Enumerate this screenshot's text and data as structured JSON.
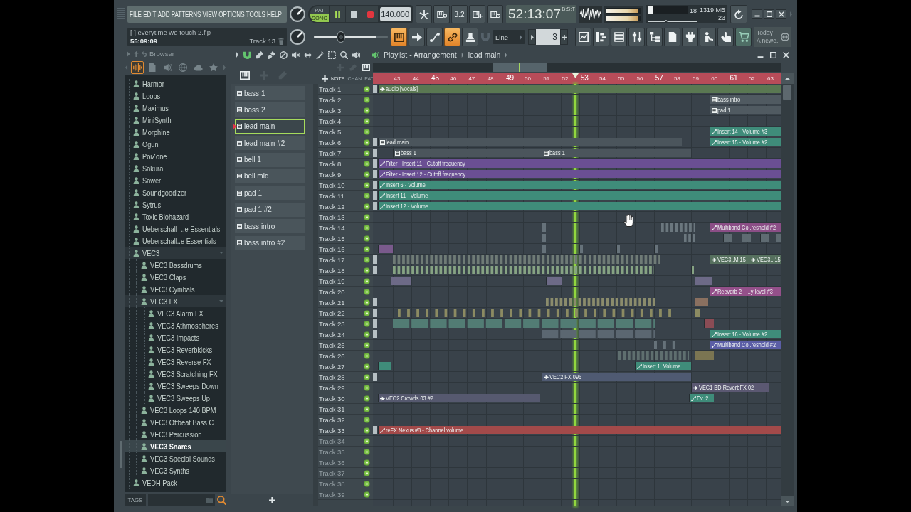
{
  "menu": [
    "FILE",
    "EDIT",
    "ADD",
    "PATTERNS",
    "VIEW",
    "OPTIONS",
    "TOOLS",
    "HELP"
  ],
  "hint_bar": {
    "title": "[ ] everytime we touch 2.flp",
    "time": "55:09:09",
    "target": "Track 13"
  },
  "transport": {
    "modes": [
      {
        "label": "PAT",
        "selected": false
      },
      {
        "label": "SONG",
        "selected": true
      }
    ],
    "playing": true,
    "tempo": "140.000"
  },
  "record_options": [
    {
      "kind": "metronome",
      "on": false
    },
    {
      "kind": "wait",
      "on": false
    },
    {
      "kind": "countdown",
      "label": "3.2",
      "on": false
    },
    {
      "kind": "step",
      "on": false
    },
    {
      "kind": "loop",
      "on": false
    }
  ],
  "song_position": {
    "time": "52:13:07",
    "unit": "B:S:T"
  },
  "output": {
    "meters": [
      {
        "level": 0.93
      },
      {
        "level": 0.93
      }
    ]
  },
  "performance": {
    "cpu": {
      "level": 0.12
    },
    "cpu_reading": "18",
    "memory": "1319 MB",
    "polyphony": "23"
  },
  "master_pitch": {
    "level": 0.37
  },
  "tools": [
    {
      "kind": "typing",
      "on": true
    },
    {
      "kind": "arrow",
      "on": false
    },
    {
      "kind": "curve",
      "on": false
    },
    {
      "kind": "link",
      "on": true
    },
    {
      "kind": "stamp",
      "on": false
    }
  ],
  "snap": {
    "value": "Line"
  },
  "pattern_number": {
    "value": "3"
  },
  "windows": [
    {
      "kind": "playlist"
    },
    {
      "kind": "piano_roll"
    },
    {
      "kind": "channel_rack"
    },
    {
      "kind": "mixer"
    },
    {
      "kind": "project"
    },
    {
      "kind": "document"
    },
    {
      "kind": "plugin"
    },
    {
      "kind": "figure"
    },
    {
      "kind": "touch"
    },
    {
      "kind": "shop"
    }
  ],
  "news": {
    "title": "Today",
    "text": "A newe.."
  },
  "browser": {
    "title": "Browser",
    "tabs": [
      {
        "kind": "all",
        "selected": true
      },
      {
        "kind": "files",
        "selected": false
      },
      {
        "kind": "plugins",
        "selected": false
      },
      {
        "kind": "online",
        "selected": false
      },
      {
        "kind": "cloud",
        "selected": false
      },
      {
        "kind": "favorites",
        "selected": false
      }
    ],
    "tree": [
      {
        "label": "Harmor",
        "expanded": false,
        "selected": false
      },
      {
        "label": "Loops",
        "expanded": false,
        "selected": false
      },
      {
        "label": "Maximus",
        "expanded": false,
        "selected": false
      },
      {
        "label": "MiniSynth",
        "expanded": false,
        "selected": false
      },
      {
        "label": "Morphine",
        "expanded": false,
        "selected": false
      },
      {
        "label": "Ogun",
        "expanded": false,
        "selected": false
      },
      {
        "label": "PoiZone",
        "expanded": false,
        "selected": false
      },
      {
        "label": "Sakura",
        "expanded": false,
        "selected": false
      },
      {
        "label": "Sawer",
        "expanded": false,
        "selected": false
      },
      {
        "label": "Soundgoodizer",
        "expanded": false,
        "selected": false
      },
      {
        "label": "Sytrus",
        "expanded": false,
        "selected": false
      },
      {
        "label": "Toxic Biohazard",
        "expanded": false,
        "selected": false
      },
      {
        "label": "Ueberschall -..e Essentials",
        "expanded": false,
        "selected": false
      },
      {
        "label": "Ueberschall..e Essentials",
        "expanded": false,
        "selected": false
      },
      {
        "label": "VEC3",
        "expanded": true,
        "selected": false,
        "children": [
          {
            "label": "VEC3 Bassdrums",
            "expanded": false,
            "selected": false
          },
          {
            "label": "VEC3 Claps",
            "expanded": false,
            "selected": false
          },
          {
            "label": "VEC3 Cymbals",
            "expanded": false,
            "selected": false
          },
          {
            "label": "VEC3 FX",
            "expanded": true,
            "selected": false,
            "children": [
              {
                "label": "VEC3 Alarm FX",
                "expanded": false,
                "selected": false
              },
              {
                "label": "VEC3 Athmospheres",
                "expanded": false,
                "selected": false
              },
              {
                "label": "VEC3 Impacts",
                "expanded": false,
                "selected": false
              },
              {
                "label": "VEC3 Reverbkicks",
                "expanded": false,
                "selected": false
              },
              {
                "label": "VEC3 Reverse FX",
                "expanded": false,
                "selected": false
              },
              {
                "label": "VEC3 Scratching FX",
                "expanded": false,
                "selected": false
              },
              {
                "label": "VEC3 Sweeps Down",
                "expanded": false,
                "selected": false
              },
              {
                "label": "VEC3 Sweeps Up",
                "expanded": false,
                "selected": false
              }
            ]
          },
          {
            "label": "VEC3 Loops 140 BPM",
            "expanded": false,
            "selected": false
          },
          {
            "label": "VEC3 Offbeat Bass C",
            "expanded": false,
            "selected": false
          },
          {
            "label": "VEC3 Percussion",
            "expanded": false,
            "selected": false
          },
          {
            "label": "VEC3 Snares",
            "expanded": false,
            "selected": true
          },
          {
            "label": "VEC3 Special Sounds",
            "expanded": false,
            "selected": false
          },
          {
            "label": "VEC3 Synths",
            "expanded": false,
            "selected": false
          }
        ]
      },
      {
        "label": "VEDH Pack",
        "expanded": false,
        "selected": false
      }
    ],
    "tags_label": "TAGS"
  },
  "playlist": {
    "title": "Playlist - Arrangement",
    "pattern": "lead main",
    "patterns": [
      {
        "label": "bass 1",
        "selected": false
      },
      {
        "label": "bass 2",
        "selected": false
      },
      {
        "label": "lead main",
        "selected": true
      },
      {
        "label": "lead main #2",
        "selected": false
      },
      {
        "label": "bell 1",
        "selected": false
      },
      {
        "label": "bell mid",
        "selected": false
      },
      {
        "label": "pad 1",
        "selected": false
      },
      {
        "label": "pad 1 #2",
        "selected": false
      },
      {
        "label": "bass intro",
        "selected": false
      },
      {
        "label": "bass intro #2",
        "selected": false
      }
    ],
    "filters": [
      {
        "label": "NOTE",
        "selected": true
      },
      {
        "label": "CHAN",
        "selected": false
      },
      {
        "label": "PAT",
        "selected": false
      }
    ],
    "ruler": [
      "43",
      "44",
      "45",
      "46",
      "47",
      "48",
      "49",
      "50",
      "51",
      "52",
      "53",
      "54",
      "55",
      "56",
      "57",
      "58",
      "59",
      "60",
      "61",
      "62",
      "63"
    ],
    "tracks": [
      {
        "name": "Track 1",
        "on": true,
        "dim": false,
        "earlier": true,
        "clips": [
          {
            "kind": "audio",
            "label": "audio [vocals]",
            "color": "#5a7852"
          }
        ]
      },
      {
        "name": "Track 2",
        "on": true,
        "dim": false,
        "earlier": false,
        "clips": [
          {
            "kind": "pattern",
            "label": "bass intro",
            "color": "#505a61"
          }
        ]
      },
      {
        "name": "Track 3",
        "on": true,
        "dim": false,
        "earlier": false,
        "clips": [
          {
            "kind": "pattern",
            "label": "pad 1",
            "color": "#505a61"
          }
        ]
      },
      {
        "name": "Track 4",
        "on": true,
        "dim": false,
        "earlier": false
      },
      {
        "name": "Track 5",
        "on": true,
        "dim": false,
        "earlier": false,
        "clips": [
          {
            "kind": "automation",
            "label": "Insert 14 - Volume #3",
            "color": "#3f8c7a"
          }
        ]
      },
      {
        "name": "Track 6",
        "on": true,
        "dim": false,
        "earlier": true,
        "clips": [
          {
            "kind": "pattern",
            "label": "lead main",
            "color": "#4b555c"
          },
          {
            "kind": "automation",
            "label": "Insert 15 - Volume #2",
            "color": "#3f8c7a"
          }
        ]
      },
      {
        "name": "Track 7",
        "on": true,
        "dim": false,
        "earlier": true,
        "clips": [
          {
            "kind": "pattern",
            "label": "bass 1",
            "color": "#4b555c"
          },
          {
            "kind": "pattern",
            "label": "bass 1",
            "color": "#4b555c"
          }
        ]
      },
      {
        "name": "Track 8",
        "on": true,
        "dim": false,
        "earlier": true,
        "clips": [
          {
            "kind": "automation",
            "label": "Filter - Insert 11 - Cutoff frequency",
            "color": "#6a4f93"
          }
        ]
      },
      {
        "name": "Track 9",
        "on": true,
        "dim": false,
        "earlier": true,
        "clips": [
          {
            "kind": "automation",
            "label": "Filter - Insert 12 - Cutoff frequency",
            "color": "#6a4f93"
          }
        ]
      },
      {
        "name": "Track 10",
        "on": true,
        "dim": false,
        "earlier": true,
        "clips": [
          {
            "kind": "automation",
            "label": "Insert 6 - Volume",
            "color": "#3f8c7a"
          }
        ]
      },
      {
        "name": "Track 11",
        "on": true,
        "dim": false,
        "earlier": true,
        "clips": [
          {
            "kind": "automation",
            "label": "Insert 11 - Volume",
            "color": "#3f8c7a"
          }
        ]
      },
      {
        "name": "Track 12",
        "on": true,
        "dim": false,
        "earlier": true,
        "clips": [
          {
            "kind": "automation",
            "label": "Insert 12 - Volume",
            "color": "#3f8c7a"
          }
        ]
      },
      {
        "name": "Track 13",
        "on": true,
        "dim": false,
        "earlier": false
      },
      {
        "name": "Track 14",
        "on": true,
        "dim": false,
        "earlier": false,
        "clips": [
          {
            "kind": "pattern",
            "color": "#66727a"
          },
          {
            "kind": "beats",
            "color": "#6b777e"
          },
          {
            "kind": "automation",
            "label": "Multiband Co..reshold #2",
            "color": "#8b4e86"
          }
        ]
      },
      {
        "name": "Track 15",
        "on": true,
        "dim": false,
        "earlier": false,
        "clips": [
          {
            "kind": "pattern",
            "color": "#66727a"
          },
          {
            "kind": "beats",
            "color": "#6b777e"
          },
          {
            "kind": "audio",
            "color": "#5f6b72"
          },
          {
            "kind": "audio",
            "color": "#5f6b72"
          },
          {
            "kind": "audio",
            "color": "#5f6b72"
          },
          {
            "kind": "audio",
            "color": "#5f6b72"
          }
        ]
      },
      {
        "name": "Track 16",
        "on": true,
        "dim": false,
        "earlier": false,
        "clips": [
          {
            "kind": "audio",
            "color": "#7a5a8c"
          },
          {
            "kind": "pattern",
            "color": "#66727a"
          },
          {
            "kind": "pattern",
            "color": "#66727a"
          },
          {
            "kind": "pattern",
            "color": "#66727a"
          },
          {
            "kind": "pattern",
            "color": "#66727a"
          }
        ]
      },
      {
        "name": "Track 17",
        "on": true,
        "dim": false,
        "earlier": true,
        "clips": [
          {
            "kind": "beats",
            "color": "#6f7b76"
          },
          {
            "kind": "audio",
            "label": "VEC3..M 15",
            "color": "#56705e"
          },
          {
            "kind": "audio",
            "label": "VEC3...15",
            "color": "#56705e"
          }
        ]
      },
      {
        "name": "Track 18",
        "on": true,
        "dim": false,
        "earlier": true,
        "clips": [
          {
            "kind": "beats",
            "color": "#86a383"
          },
          {
            "kind": "pattern",
            "color": "#86a383"
          }
        ]
      },
      {
        "name": "Track 19",
        "on": true,
        "dim": false,
        "earlier": false,
        "clips": [
          {
            "kind": "audio",
            "color": "#6d6a87"
          },
          {
            "kind": "audio",
            "color": "#6d6a87"
          },
          {
            "kind": "audio",
            "color": "#6d6a87"
          }
        ]
      },
      {
        "name": "Track 20",
        "on": true,
        "dim": false,
        "earlier": false,
        "clips": [
          {
            "kind": "automation",
            "label": "Reeverb 2 - I..y level #3",
            "color": "#94508a"
          }
        ]
      },
      {
        "name": "Track 21",
        "on": true,
        "dim": false,
        "earlier": true,
        "clips": [
          {
            "kind": "beats",
            "color": "#8b8c6c"
          },
          {
            "kind": "audio",
            "color": "#8a7060"
          }
        ]
      },
      {
        "name": "Track 22",
        "on": true,
        "dim": false,
        "earlier": true,
        "clips": [
          {
            "kind": "offbeats",
            "color": "#8c8b62"
          },
          {
            "kind": "pattern",
            "color": "#8c8b62"
          }
        ]
      },
      {
        "name": "Track 23",
        "on": true,
        "dim": false,
        "earlier": true,
        "clips": [
          {
            "kind": "bars",
            "color": "#527c74"
          },
          {
            "kind": "audio",
            "color": "#8b4c55"
          }
        ]
      },
      {
        "name": "Track 24",
        "on": true,
        "dim": false,
        "earlier": true,
        "clips": [
          {
            "kind": "bars",
            "color": "#5b6771"
          },
          {
            "kind": "automation",
            "label": "Insert 16 - Volume #2",
            "color": "#3f8c7a"
          }
        ]
      },
      {
        "name": "Track 25",
        "on": true,
        "dim": false,
        "earlier": false,
        "clips": [
          {
            "kind": "offbeats",
            "color": "#66727a"
          },
          {
            "kind": "automation",
            "label": "Multiband Co..reshold #2",
            "color": "#5b5ea6"
          }
        ]
      },
      {
        "name": "Track 26",
        "on": true,
        "dim": false,
        "earlier": false,
        "clips": [
          {
            "kind": "beats",
            "color": "#5f6f6f"
          },
          {
            "kind": "audio",
            "color": "#7b7552"
          }
        ]
      },
      {
        "name": "Track 27",
        "on": true,
        "dim": false,
        "earlier": false,
        "clips": [
          {
            "kind": "automation",
            "color": "#3f8c7a"
          },
          {
            "kind": "automation",
            "label": "Insert 1..Volume",
            "color": "#3f8c7a"
          }
        ]
      },
      {
        "name": "Track 28",
        "on": true,
        "dim": false,
        "earlier": true,
        "clips": [
          {
            "kind": "audio",
            "label": "VEC2 FX 096",
            "color": "#4f5a72"
          }
        ]
      },
      {
        "name": "Track 29",
        "on": true,
        "dim": false,
        "earlier": false,
        "clips": [
          {
            "kind": "audio",
            "label": "VEC1 BD ReverbFX 02",
            "color": "#5b5872"
          }
        ]
      },
      {
        "name": "Track 30",
        "on": true,
        "dim": false,
        "earlier": false,
        "clips": [
          {
            "kind": "audio",
            "label": "VEC2 Crowds 03 #2",
            "color": "#56596f"
          },
          {
            "kind": "automation",
            "label": "Ev..2",
            "color": "#3f8c7a"
          }
        ]
      },
      {
        "name": "Track 31",
        "on": true,
        "dim": false,
        "earlier": false
      },
      {
        "name": "Track 32",
        "on": true,
        "dim": false,
        "earlier": false
      },
      {
        "name": "Track 33",
        "on": true,
        "dim": false,
        "earlier": true,
        "clips": [
          {
            "kind": "automation",
            "label": "reFX Nexus #8 - Channel volume",
            "color": "#a34a4a"
          }
        ]
      },
      {
        "name": "Track 34",
        "on": true,
        "dim": true,
        "earlier": false
      },
      {
        "name": "Track 35",
        "on": true,
        "dim": true,
        "earlier": false
      },
      {
        "name": "Track 36",
        "on": true,
        "dim": true,
        "earlier": false
      },
      {
        "name": "Track 37",
        "on": true,
        "dim": true,
        "earlier": false
      },
      {
        "name": "Track 38",
        "on": true,
        "dim": true,
        "earlier": false
      },
      {
        "name": "Track 39",
        "on": true,
        "dim": true,
        "earlier": false
      }
    ]
  }
}
